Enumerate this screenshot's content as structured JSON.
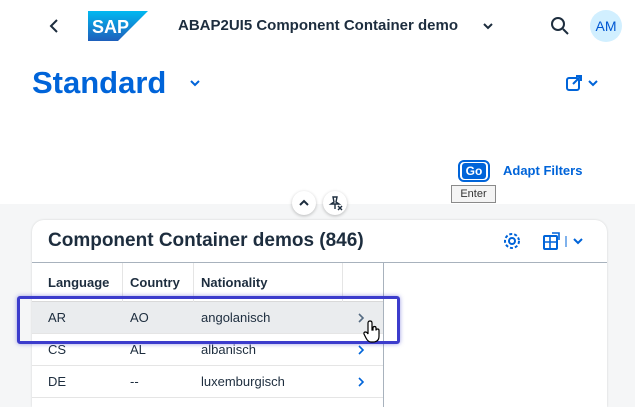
{
  "shell": {
    "logo_text": "SAP",
    "title": "ABAP2UI5 Component Container demo",
    "avatar_initials": "AM"
  },
  "header": {
    "variant": "Standard",
    "go_label": "Go",
    "go_tooltip": "Enter",
    "adapt_filters_label": "Adapt Filters"
  },
  "table": {
    "title": "Component Container demos (846)",
    "columns": [
      "Language",
      "Country",
      "Nationality"
    ],
    "rows": [
      {
        "language": "AR",
        "country": "AO",
        "nationality": "angolanisch"
      },
      {
        "language": "CS",
        "country": "AL",
        "nationality": "albanisch"
      },
      {
        "language": "DE",
        "country": "--",
        "nationality": "luxemburgisch"
      }
    ]
  },
  "colors": {
    "accent": "#0064d9",
    "highlight_border": "#3c3ccc",
    "row_hover": "#eaecee"
  },
  "icons": [
    "back-icon",
    "chevron-down-icon",
    "search-icon",
    "share-icon",
    "chevron-up-icon",
    "unpin-icon",
    "settings-icon",
    "export-icon",
    "nav-chevron-icon",
    "hand-cursor-icon"
  ]
}
